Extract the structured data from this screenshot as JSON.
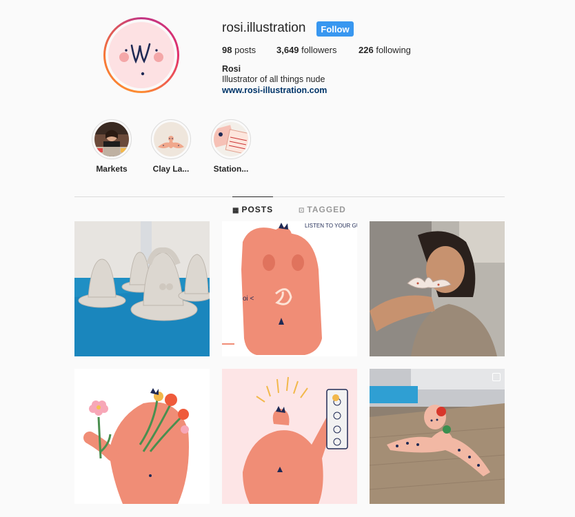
{
  "profile": {
    "username": "rosi.illustration",
    "follow_label": "Follow",
    "posts_count": "98",
    "posts_label": "posts",
    "followers_count": "3,649",
    "followers_label": "followers",
    "following_count": "226",
    "following_label": "following",
    "full_name": "Rosi",
    "bio": "Illustrator of all things nude",
    "website": "www.rosi-illustration.com"
  },
  "highlights": [
    {
      "label": "Markets"
    },
    {
      "label": "Clay La..."
    },
    {
      "label": "Station..."
    }
  ],
  "tabs": {
    "posts": "POSTS",
    "tagged": "TAGGED"
  },
  "posts": [
    {
      "caption": ""
    },
    {
      "caption": "LISTEN TO YOUR GUT",
      "side": "oi <"
    },
    {
      "caption": ""
    },
    {
      "caption": ""
    },
    {
      "caption": ""
    },
    {
      "caption": ""
    }
  ],
  "colors": {
    "accent": "#3897f0",
    "link": "#003569",
    "skin": "#f08d76",
    "blush": "#f4a7a8"
  }
}
